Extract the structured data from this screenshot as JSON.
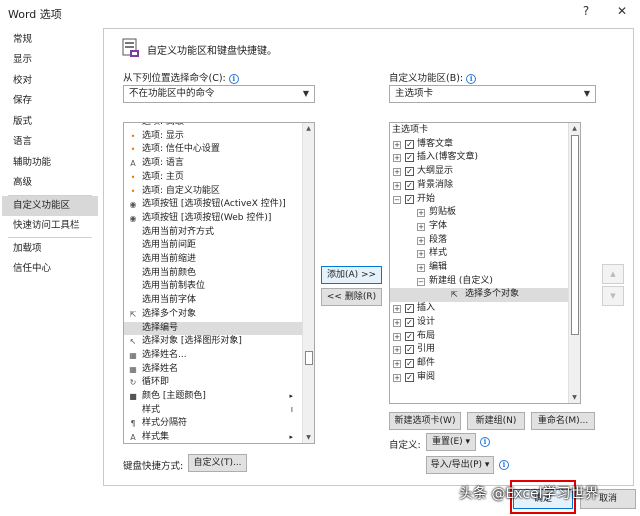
{
  "window": {
    "title": "Word 选项",
    "help": "?",
    "close": "✕"
  },
  "sidebar": {
    "items": [
      {
        "label": "常规",
        "selected": false
      },
      {
        "label": "显示",
        "selected": false
      },
      {
        "label": "校对",
        "selected": false
      },
      {
        "label": "保存",
        "selected": false
      },
      {
        "label": "版式",
        "selected": false
      },
      {
        "label": "语言",
        "selected": false
      },
      {
        "label": "辅助功能",
        "selected": false
      },
      {
        "label": "高级",
        "selected": false
      },
      {
        "label": "自定义功能区",
        "selected": true
      },
      {
        "label": "快速访问工具栏",
        "selected": false
      },
      {
        "label": "加载项",
        "selected": false
      },
      {
        "label": "信任中心",
        "selected": false
      }
    ]
  },
  "header": {
    "text": "自定义功能区和键盘快捷键。"
  },
  "left": {
    "label": "从下列位置选择命令(C):",
    "dropdown_value": "不在功能区中的命令",
    "items": [
      {
        "icon": "•",
        "label": "选项: 高级",
        "sub": ""
      },
      {
        "icon": "•",
        "label": "选项: 显示",
        "sub": ""
      },
      {
        "icon": "•",
        "label": "选项: 信任中心设置",
        "sub": ""
      },
      {
        "icon": "A",
        "label": "选项: 语言",
        "sub": ""
      },
      {
        "icon": "•",
        "label": "选项: 主页",
        "sub": ""
      },
      {
        "icon": "•",
        "label": "选项: 自定义功能区",
        "sub": ""
      },
      {
        "icon": "◉",
        "label": "选项按钮 [选项按钮(ActiveX 控件)]",
        "sub": ""
      },
      {
        "icon": "◉",
        "label": "选项按钮 [选项按钮(Web 控件)]",
        "sub": ""
      },
      {
        "icon": "",
        "label": "选用当前对齐方式",
        "sub": ""
      },
      {
        "icon": "",
        "label": "选用当前间距",
        "sub": ""
      },
      {
        "icon": "",
        "label": "选用当前缩进",
        "sub": ""
      },
      {
        "icon": "",
        "label": "选用当前颜色",
        "sub": ""
      },
      {
        "icon": "",
        "label": "选用当前制表位",
        "sub": ""
      },
      {
        "icon": "",
        "label": "选用当前字体",
        "sub": ""
      },
      {
        "icon": "⇱",
        "label": "选择多个对象",
        "sub": ""
      },
      {
        "icon": "",
        "label": "选择编号",
        "sub": "",
        "selected": true
      },
      {
        "icon": "↖",
        "label": "选择对象 [选择图形对象]",
        "sub": ""
      },
      {
        "icon": "▦",
        "label": "选择姓名...",
        "sub": ""
      },
      {
        "icon": "▦",
        "label": "选择姓名",
        "sub": ""
      },
      {
        "icon": "↻",
        "label": "循环即",
        "sub": ""
      },
      {
        "icon": "■",
        "label": "颜色 [主题颜色]",
        "sub": "▸"
      },
      {
        "icon": "",
        "label": "样式",
        "sub": "I"
      },
      {
        "icon": "¶",
        "label": "样式分隔符",
        "sub": ""
      },
      {
        "icon": "A",
        "label": "样式集",
        "sub": "▸"
      }
    ]
  },
  "middle": {
    "add_button": "添加(A) >>",
    "remove_button": "<< 删除(R)"
  },
  "right": {
    "label": "自定义功能区(B):",
    "dropdown_value": "主选项卡",
    "tree": [
      {
        "level": 0,
        "expander": "",
        "checked": null,
        "label": "主选项卡",
        "header": true
      },
      {
        "level": 1,
        "expander": "+",
        "checked": true,
        "label": "博客文章"
      },
      {
        "level": 1,
        "expander": "+",
        "checked": true,
        "label": "插入(博客文章)"
      },
      {
        "level": 1,
        "expander": "+",
        "checked": true,
        "label": "大纲显示"
      },
      {
        "level": 1,
        "expander": "+",
        "checked": true,
        "label": "背景消除"
      },
      {
        "level": 1,
        "expander": "−",
        "checked": true,
        "label": "开始"
      },
      {
        "level": 2,
        "expander": "+",
        "checked": null,
        "label": "剪贴板"
      },
      {
        "level": 2,
        "expander": "+",
        "checked": null,
        "label": "字体"
      },
      {
        "level": 2,
        "expander": "+",
        "checked": null,
        "label": "段落"
      },
      {
        "level": 2,
        "expander": "+",
        "checked": null,
        "label": "样式"
      },
      {
        "level": 2,
        "expander": "+",
        "checked": null,
        "label": "编辑"
      },
      {
        "level": 2,
        "expander": "−",
        "checked": null,
        "label": "新建组 (自定义)"
      },
      {
        "level": 3,
        "expander": "",
        "checked": null,
        "label": "选择多个对象",
        "icon": "⇱",
        "selected": true
      },
      {
        "level": 1,
        "expander": "+",
        "checked": true,
        "label": "插入"
      },
      {
        "level": 1,
        "expander": "+",
        "checked": true,
        "label": "设计"
      },
      {
        "level": 1,
        "expander": "+",
        "checked": true,
        "label": "布局"
      },
      {
        "level": 1,
        "expander": "+",
        "checked": true,
        "label": "引用"
      },
      {
        "level": 1,
        "expander": "+",
        "checked": true,
        "label": "邮件"
      },
      {
        "level": 1,
        "expander": "+",
        "checked": true,
        "label": "审阅"
      }
    ],
    "new_tab_button": "新建选项卡(W)",
    "new_group_button": "新建组(N)",
    "rename_button": "重命名(M)...",
    "customize_label": "自定义:",
    "reset_button": "重置(E) ▾",
    "import_export_button": "导入/导出(P) ▾"
  },
  "keyboard": {
    "label": "键盘快捷方式:",
    "button": "自定义(T)..."
  },
  "footer": {
    "ok": "确定",
    "cancel": "取消"
  },
  "watermark": "头条 @Excel学习世界"
}
